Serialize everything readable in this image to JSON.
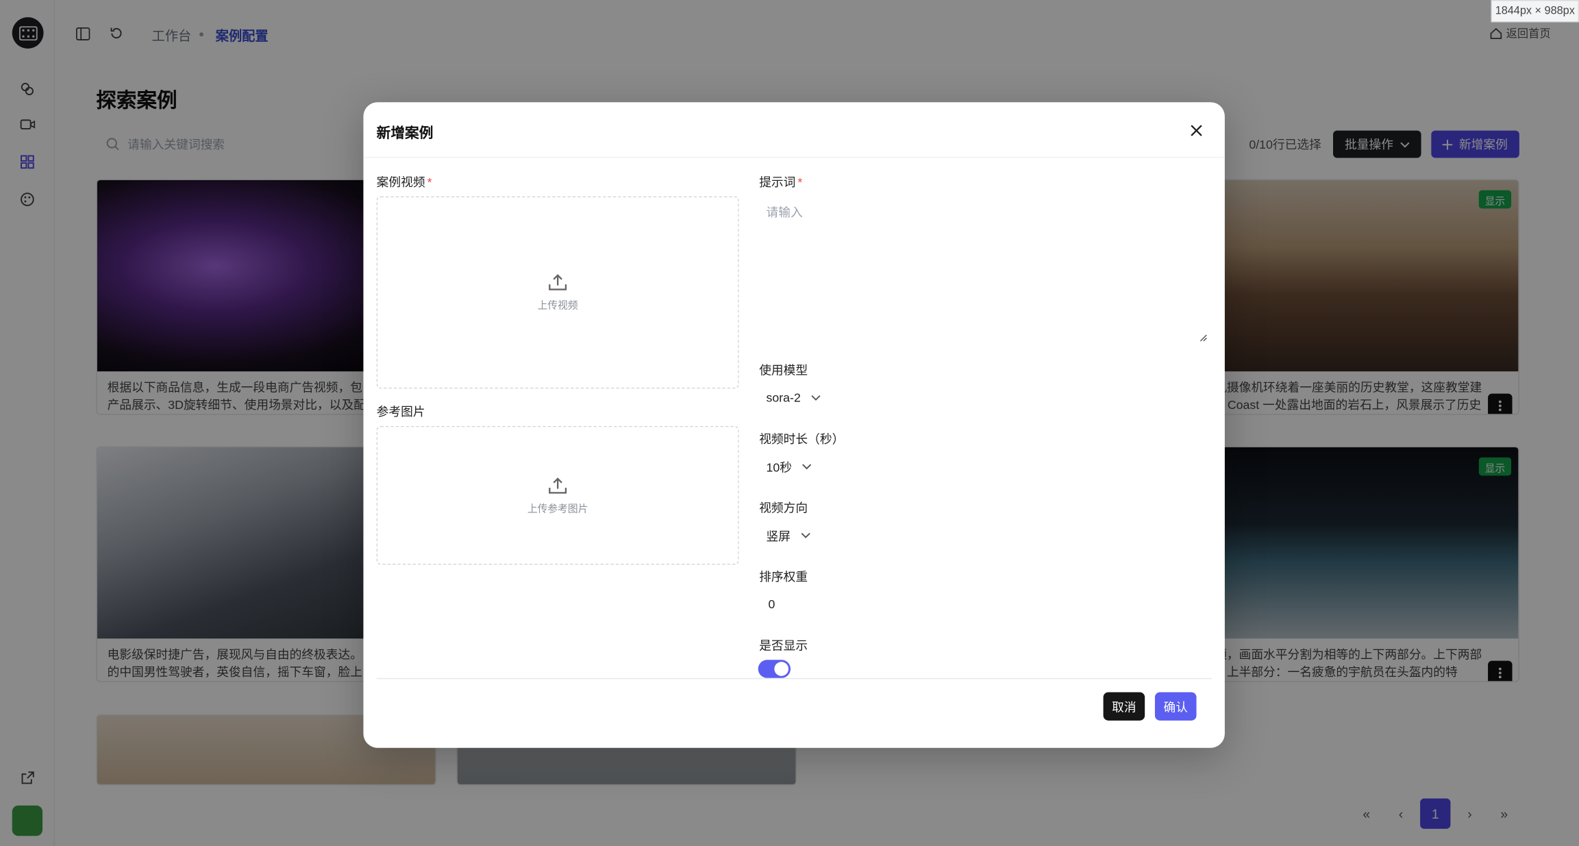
{
  "viewport_badge": "1844px × 988px",
  "breadcrumb": {
    "home": "工作台",
    "current": "案例配置"
  },
  "topbar": {
    "back_home": "返回首页"
  },
  "page": {
    "title": "探索案例",
    "search_placeholder": "请输入关键词搜索",
    "selected_count": "0/10行已选择",
    "batch_label": "批量操作",
    "add_label": "新增案例"
  },
  "cards": [
    {
      "desc1": "根据以下商品信息，生成一段电商广告视频，包",
      "desc2": "产品展示、3D旋转细节、使用场景对比，以及配"
    },
    {
      "badge": "显示",
      "desc1": "无人机摄像机环绕着一座美丽的历史教堂，这座教堂建",
      "desc2": "Amalfi Coast 一处露出地面的岩石上，风景展示了历史"
    },
    {
      "desc1": "电影级保时捷广告，展现风与自由的终极表达。",
      "desc2": "的中国男性驾驶者，英俊自信，摇下车窗，脸上"
    },
    {
      "badge": "显示",
      "desc1": "屏视频，画面水平分割为相等的上下两部分。上下两部",
      "desc2": "呼应，上半部分：一名疲惫的宇航员在头盔内的特"
    }
  ],
  "pagination": {
    "current": "1"
  },
  "modal": {
    "title": "新增案例",
    "video_label": "案例视频",
    "video_upload": "上传视频",
    "ref_label": "参考图片",
    "ref_upload": "上传参考图片",
    "prompt_label": "提示词",
    "prompt_placeholder": "请输入",
    "model_label": "使用模型",
    "model_value": "sora-2",
    "duration_label": "视频时长（秒）",
    "duration_value": "10秒",
    "orientation_label": "视频方向",
    "orientation_value": "竖屏",
    "weight_label": "排序权重",
    "weight_value": "0",
    "visible_label": "是否显示",
    "visible_on": true,
    "cancel": "取消",
    "confirm": "确认"
  },
  "colors": {
    "accent": "#5b5ef0",
    "primary_dark": "#161616",
    "badge_green": "#16a34a"
  }
}
